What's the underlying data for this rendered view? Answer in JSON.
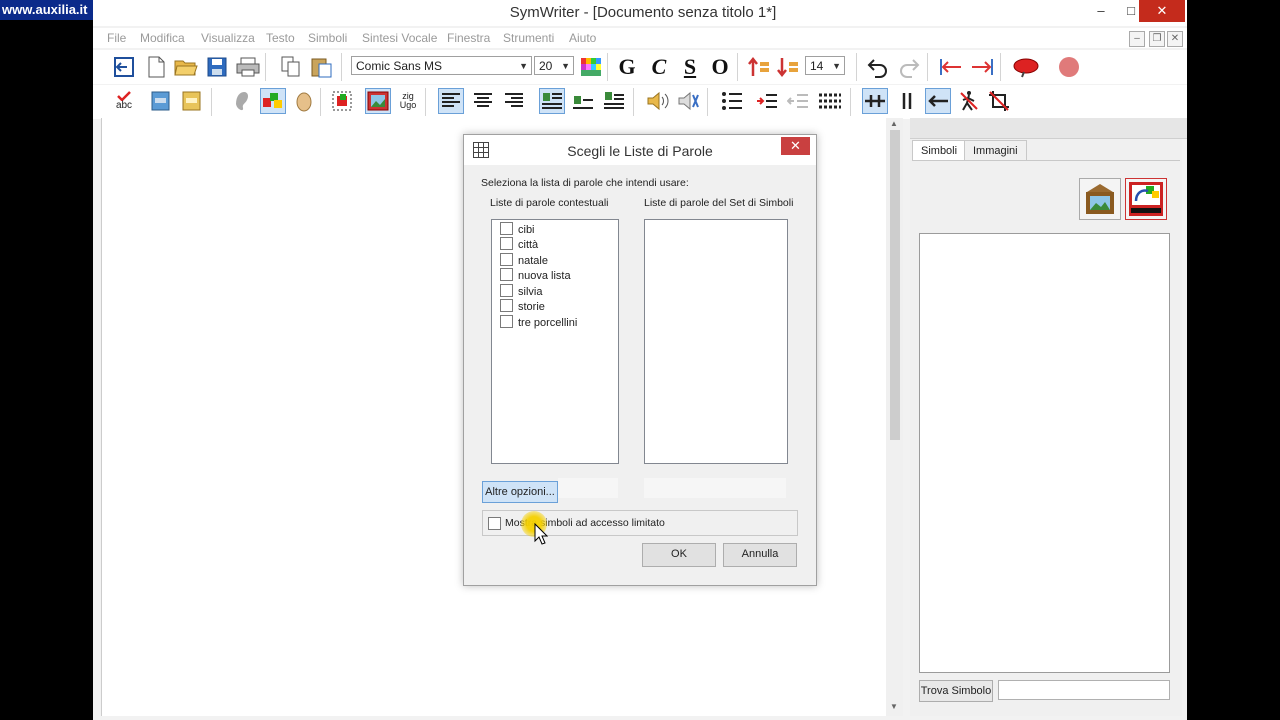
{
  "watermark": "www.auxilia.it",
  "window": {
    "title": "SymWriter - [Documento senza titolo 1*]",
    "min": "–",
    "max": "□",
    "close": "✕"
  },
  "menu": [
    "File",
    "Modifica",
    "Visualizza",
    "Testo",
    "Simboli",
    "Sintesi Vocale",
    "Finestra",
    "Strumenti",
    "Aiuto"
  ],
  "mdi": {
    "min": "–",
    "restore": "❐",
    "close": "✕"
  },
  "toolbar": {
    "font": "Comic Sans MS",
    "size": "20",
    "size2": "14",
    "bold": "G",
    "italic": "C",
    "underline": "S",
    "outline": "O",
    "spell_label": "abc",
    "zig_label": "zig",
    "zag_label": "Ugo"
  },
  "right_panel": {
    "tabs": [
      "Simboli",
      "Immagini"
    ],
    "find_button": "Trova Simbolo",
    "find_value": ""
  },
  "dialog": {
    "title": "Scegli le Liste di Parole",
    "prompt": "Seleziona la lista di parole che intendi usare:",
    "col_left": "Liste di parole contestuali",
    "col_right": "Liste di parole del Set di Simboli",
    "lists": [
      "cibi",
      "città",
      "natale",
      "nuova lista",
      "silvia",
      "storie",
      "tre porcellini"
    ],
    "more_options": "Altre opzioni...",
    "restricted_checkbox": "Mostra simboli ad accesso limitato",
    "ok": "OK",
    "cancel": "Annulla"
  },
  "colors": {
    "accent": "#0b2a8a",
    "close_red": "#c42b1c",
    "highlight": "#cfe3f7",
    "cursor_halo": "#f5d000"
  }
}
